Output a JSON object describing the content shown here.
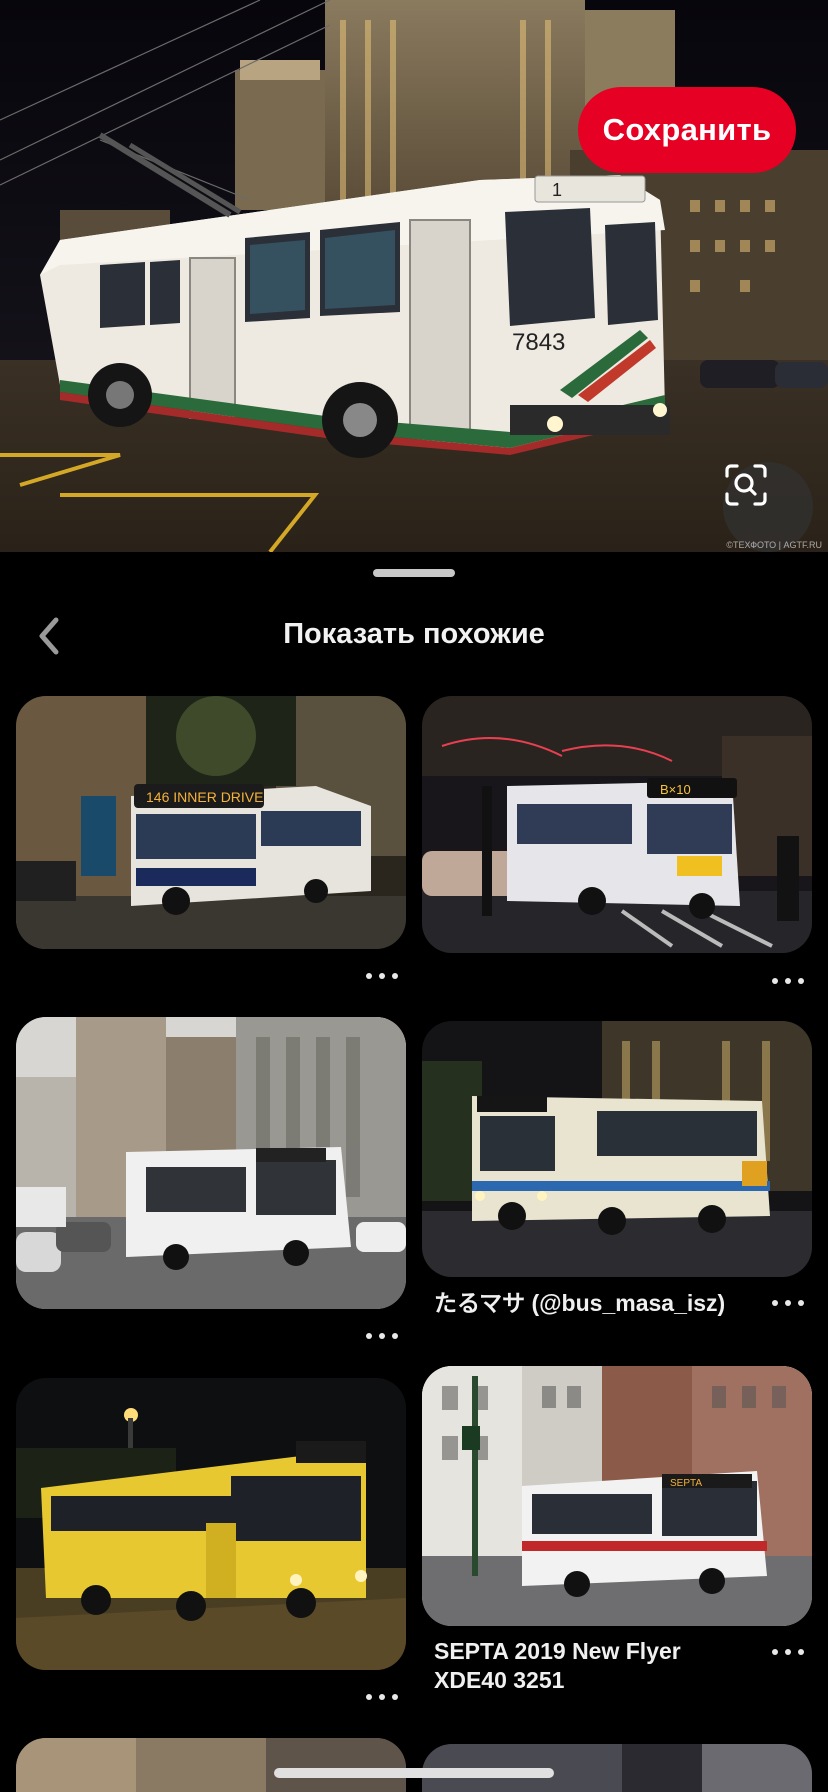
{
  "hero": {
    "save_label": "Сохранить",
    "credit": "©ТЕХФОТО | AGTF.RU",
    "route_number": "1",
    "fleet_number": "7843"
  },
  "header": {
    "title": "Показать похожие"
  },
  "pins": [
    {
      "id": "pin-1",
      "caption": "",
      "sign": "146  INNER DRIVE"
    },
    {
      "id": "pin-2",
      "caption": "",
      "sign": "B×10"
    },
    {
      "id": "pin-3",
      "caption": "",
      "sign": ""
    },
    {
      "id": "pin-4",
      "caption": "たるマサ (@bus_masa_isz)",
      "sign": ""
    },
    {
      "id": "pin-5",
      "caption": "",
      "sign": ""
    },
    {
      "id": "pin-6",
      "caption_line1": "SEPTA 2019 New Flyer",
      "caption_line2": "XDE40 3251",
      "sign": "SEPTA"
    }
  ],
  "colors": {
    "brand": "#e60023",
    "background": "#000000"
  },
  "icons": {
    "back": "chevron-left-icon",
    "lens": "visual-search-icon",
    "more": "more-horizontal-icon"
  }
}
